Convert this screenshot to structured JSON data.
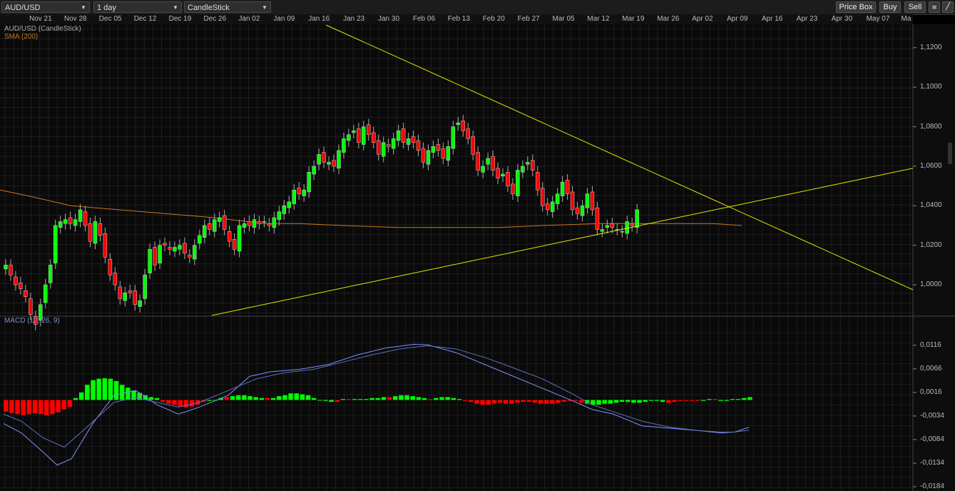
{
  "toolbar": {
    "symbol": "AUD/USD",
    "interval": "1 day",
    "chart_type": "CandleStick",
    "price_box_label": "Price Box",
    "buy_label": "Buy",
    "sell_label": "Sell"
  },
  "colors": {
    "up": "#00ff00",
    "down": "#ff0000",
    "sma": "#c87820",
    "trendline": "#e6e600",
    "macd_line": "#8090ff",
    "signal_line": "#6070c0",
    "grid": "#2a2a2a"
  },
  "chart_data": [
    {
      "type": "candlestick",
      "title": "AUD/USD (CandleStick)",
      "sma_label": "SMA (200)",
      "x_ticks": [
        "Nov 21",
        "Nov 28",
        "Dec 05",
        "Dec 12",
        "Dec 19",
        "Dec 26",
        "Jan 02",
        "Jan 09",
        "Jan 16",
        "Jan 23",
        "Jan 30",
        "Feb 06",
        "Feb 13",
        "Feb 20",
        "Feb 27",
        "Mar 05",
        "Mar 12",
        "Mar 19",
        "Mar 26",
        "Apr 02",
        "Apr 09",
        "Apr 16",
        "Apr 23",
        "Apr 30",
        "May 07",
        "Ma"
      ],
      "y_ticks": [
        "1,1200",
        "1,1000",
        "1,0800",
        "1,0600",
        "1,0400",
        "1,0200",
        "1,0000"
      ],
      "y_tick_values": [
        1.12,
        1.1,
        1.08,
        1.06,
        1.04,
        1.02,
        1.0
      ],
      "ylim": [
        0.9845,
        1.1315
      ],
      "closes": [
        1.01,
        1.005,
        1.0,
        0.998,
        0.994,
        0.985,
        0.98,
        0.99,
        1.0,
        1.01,
        1.03,
        1.032,
        1.033,
        1.031,
        1.033,
        1.038,
        1.03,
        1.022,
        1.032,
        1.025,
        1.014,
        1.005,
        1.0,
        0.993,
        0.996,
        0.996,
        0.99,
        0.992,
        1.005,
        1.018,
        1.01,
        1.02,
        1.02,
        1.018,
        1.019,
        1.02,
        1.016,
        1.014,
        1.02,
        1.025,
        1.03,
        1.028,
        1.033,
        1.034,
        1.028,
        1.022,
        1.018,
        1.03,
        1.031,
        1.03,
        1.033,
        1.031,
        1.032,
        1.03,
        1.034,
        1.037,
        1.04,
        1.042,
        1.048,
        1.046,
        1.048,
        1.057,
        1.06,
        1.066,
        1.062,
        1.062,
        1.06,
        1.068,
        1.074,
        1.076,
        1.078,
        1.072,
        1.08,
        1.076,
        1.072,
        1.066,
        1.072,
        1.07,
        1.074,
        1.078,
        1.072,
        1.074,
        1.072,
        1.068,
        1.062,
        1.068,
        1.07,
        1.068,
        1.064,
        1.07,
        1.08,
        1.082,
        1.078,
        1.074,
        1.066,
        1.058,
        1.06,
        1.064,
        1.058,
        1.054,
        1.056,
        1.05,
        1.046,
        1.058,
        1.06,
        1.062,
        1.058,
        1.048,
        1.04,
        1.038,
        1.042,
        1.046,
        1.052,
        1.046,
        1.038,
        1.036,
        1.04,
        1.046,
        1.038,
        1.028,
        1.028,
        1.03,
        1.029,
        1.028,
        1.027,
        1.032,
        1.03,
        1.038,
        1.037
      ],
      "opens": [
        1.008,
        1.01,
        1.004,
        1.001,
        0.997,
        0.993,
        0.984,
        0.982,
        0.991,
        1.001,
        1.011,
        1.029,
        1.031,
        1.034,
        1.03,
        1.032,
        1.037,
        1.031,
        1.021,
        1.031,
        1.026,
        1.013,
        1.006,
        0.999,
        0.992,
        0.997,
        0.997,
        0.989,
        0.993,
        1.006,
        1.019,
        1.011,
        1.021,
        1.019,
        1.017,
        1.018,
        1.021,
        1.015,
        1.013,
        1.021,
        1.024,
        1.031,
        1.027,
        1.032,
        1.035,
        1.027,
        1.023,
        1.017,
        1.029,
        1.032,
        1.029,
        1.032,
        1.032,
        1.031,
        1.029,
        1.033,
        1.036,
        1.039,
        1.041,
        1.049,
        1.045,
        1.047,
        1.056,
        1.061,
        1.067,
        1.061,
        1.063,
        1.059,
        1.067,
        1.073,
        1.077,
        1.079,
        1.071,
        1.081,
        1.077,
        1.073,
        1.065,
        1.071,
        1.069,
        1.073,
        1.079,
        1.071,
        1.075,
        1.073,
        1.069,
        1.061,
        1.067,
        1.071,
        1.069,
        1.063,
        1.069,
        1.081,
        1.083,
        1.079,
        1.075,
        1.067,
        1.057,
        1.061,
        1.065,
        1.059,
        1.055,
        1.057,
        1.051,
        1.045,
        1.057,
        1.061,
        1.063,
        1.057,
        1.049,
        1.041,
        1.037,
        1.041,
        1.045,
        1.053,
        1.047,
        1.039,
        1.035,
        1.039,
        1.047,
        1.039,
        1.027,
        1.029,
        1.031,
        1.028,
        1.027,
        1.026,
        1.031,
        1.029
      ],
      "sma": [
        [
          0,
          1.048
        ],
        [
          40,
          1.045
        ],
        [
          100,
          1.04
        ],
        [
          200,
          1.037
        ],
        [
          300,
          1.034
        ],
        [
          370,
          1.031
        ],
        [
          420,
          1.031
        ],
        [
          480,
          1.03
        ],
        [
          560,
          1.029
        ],
        [
          640,
          1.029
        ],
        [
          700,
          1.029
        ],
        [
          760,
          1.03
        ],
        [
          840,
          1.031
        ],
        [
          940,
          1.031
        ],
        [
          1000,
          1.031
        ],
        [
          1040,
          1.03
        ]
      ],
      "trendlines": [
        {
          "name": "down-trendline",
          "p1": [
            457,
            1.1315
          ],
          "p2": [
            1280,
            0.9975
          ]
        },
        {
          "name": "up-trendline",
          "p1": [
            297,
            0.9845
          ],
          "p2": [
            1280,
            1.059
          ]
        }
      ]
    },
    {
      "type": "macd",
      "title": "MACD (12, 26, 9)",
      "y_ticks": [
        "0,0116",
        "0,0066",
        "0,0016",
        "-0,0034",
        "-0,0084",
        "-0,0134",
        "-0,0184"
      ],
      "y_tick_values": [
        0.0116,
        0.0066,
        0.0016,
        -0.0034,
        -0.0084,
        -0.0134,
        -0.0184
      ],
      "ylim": [
        -0.0184,
        0.0155
      ],
      "histogram": [
        -0.0025,
        -0.0028,
        -0.003,
        -0.0032,
        -0.003,
        -0.0028,
        -0.003,
        -0.0033,
        -0.003,
        -0.0026,
        -0.002,
        -0.0015,
        0.0004,
        0.0016,
        0.0032,
        0.0042,
        0.0045,
        0.0046,
        0.0045,
        0.004,
        0.0032,
        0.0026,
        0.002,
        0.0015,
        0.001,
        0.0006,
        0.0004,
        -0.0004,
        -0.0008,
        -0.001,
        -0.0014,
        -0.0016,
        -0.0014,
        -0.001,
        -0.0004,
        -0.0002,
        0.0,
        0.0004,
        0.0006,
        0.0008,
        0.001,
        0.001,
        0.0008,
        0.0006,
        0.0004,
        0.0004,
        0.0004,
        0.0008,
        0.001,
        0.0014,
        0.0014,
        0.0012,
        0.001,
        0.0004,
        0.0,
        -0.0002,
        -0.0004,
        -0.0004,
        0.0002,
        0.0002,
        0.0002,
        0.0002,
        0.0002,
        0.0004,
        0.0004,
        0.0006,
        0.0006,
        0.0008,
        0.001,
        0.001,
        0.0008,
        0.0006,
        0.0004,
        0.0002,
        0.0004,
        0.0006,
        0.0006,
        0.0004,
        0.0002,
        -0.0002,
        -0.0004,
        -0.0008,
        -0.001,
        -0.001,
        -0.0008,
        -0.0006,
        -0.0008,
        -0.0008,
        -0.0006,
        -0.0004,
        -0.0004,
        -0.0006,
        -0.0008,
        -0.0008,
        -0.0008,
        -0.0006,
        -0.0004,
        -0.0002,
        -0.0002,
        -0.0006,
        -0.0008,
        -0.001,
        -0.001,
        -0.0008,
        -0.0008,
        -0.0006,
        -0.0004,
        -0.0004,
        -0.0006,
        -0.0006,
        -0.0004,
        -0.0002,
        -0.0002,
        -0.0004,
        -0.0006,
        -0.0004,
        -0.0002,
        -0.0002,
        -0.0002,
        -0.0002,
        -0.0002,
        0.0002,
        0.0002,
        -0.0002,
        -0.0002,
        0.0002,
        0.0002,
        0.0004,
        0.0006
      ],
      "macd_line": [
        [
          5,
          -0.005
        ],
        [
          30,
          -0.007
        ],
        [
          60,
          -0.011
        ],
        [
          80,
          -0.0138
        ],
        [
          100,
          -0.0125
        ],
        [
          130,
          -0.005
        ],
        [
          160,
          0.001
        ],
        [
          190,
          0.002
        ],
        [
          220,
          -0.001
        ],
        [
          250,
          -0.003
        ],
        [
          280,
          -0.0015
        ],
        [
          320,
          0.001
        ],
        [
          350,
          0.005
        ],
        [
          380,
          0.006
        ],
        [
          420,
          0.0065
        ],
        [
          460,
          0.0075
        ],
        [
          500,
          0.0095
        ],
        [
          540,
          0.011
        ],
        [
          580,
          0.0118
        ],
        [
          600,
          0.0117
        ],
        [
          640,
          0.01
        ],
        [
          680,
          0.0075
        ],
        [
          720,
          0.005
        ],
        [
          760,
          0.0025
        ],
        [
          800,
          0.0
        ],
        [
          830,
          -0.002
        ],
        [
          860,
          -0.003
        ],
        [
          900,
          -0.0055
        ],
        [
          940,
          -0.006
        ],
        [
          980,
          -0.0065
        ],
        [
          1010,
          -0.007
        ],
        [
          1030,
          -0.0068
        ],
        [
          1050,
          -0.0058
        ]
      ],
      "signal_line": [
        [
          5,
          -0.003
        ],
        [
          30,
          -0.0045
        ],
        [
          60,
          -0.008
        ],
        [
          90,
          -0.01
        ],
        [
          120,
          -0.006
        ],
        [
          160,
          -0.0005
        ],
        [
          190,
          0.0005
        ],
        [
          220,
          -0.0005
        ],
        [
          250,
          -0.0015
        ],
        [
          280,
          -0.0005
        ],
        [
          320,
          0.002
        ],
        [
          360,
          0.0045
        ],
        [
          400,
          0.0058
        ],
        [
          440,
          0.0065
        ],
        [
          480,
          0.008
        ],
        [
          520,
          0.0095
        ],
        [
          560,
          0.0108
        ],
        [
          600,
          0.0115
        ],
        [
          640,
          0.0108
        ],
        [
          680,
          0.009
        ],
        [
          720,
          0.0068
        ],
        [
          760,
          0.0045
        ],
        [
          800,
          0.0015
        ],
        [
          830,
          -0.001
        ],
        [
          860,
          -0.0025
        ],
        [
          900,
          -0.0045
        ],
        [
          940,
          -0.0058
        ],
        [
          980,
          -0.0065
        ],
        [
          1010,
          -0.0068
        ],
        [
          1030,
          -0.0068
        ],
        [
          1050,
          -0.0064
        ]
      ]
    }
  ]
}
